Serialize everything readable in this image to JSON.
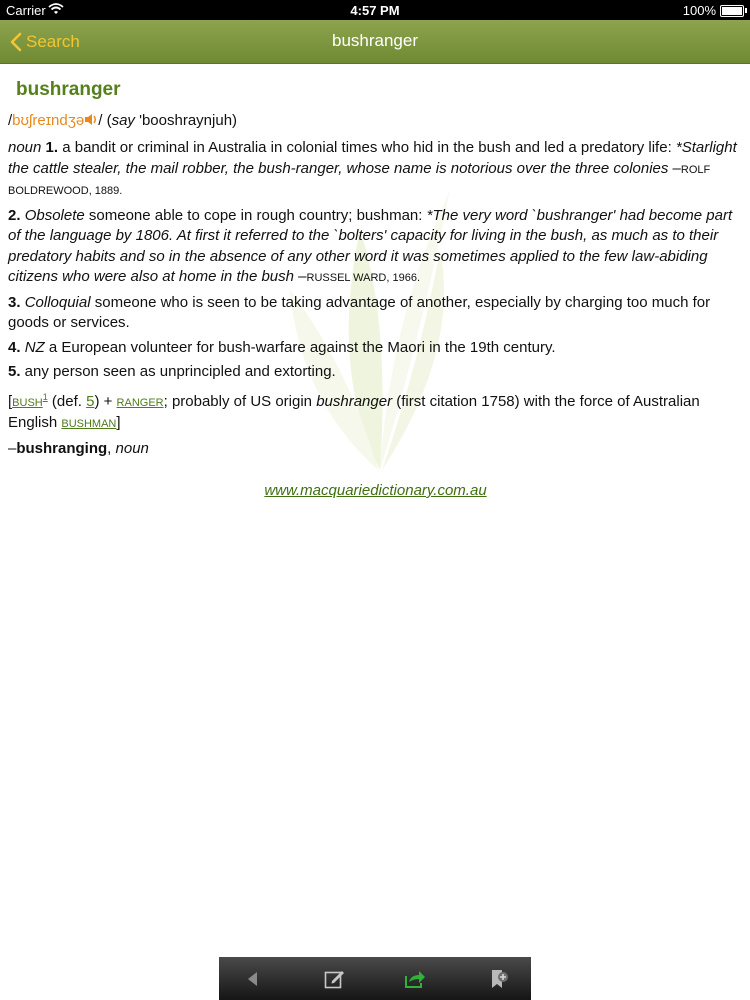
{
  "status_bar": {
    "carrier": "Carrier",
    "time": "4:57 PM",
    "battery": "100%"
  },
  "nav": {
    "back_label": "Search",
    "title": "bushranger"
  },
  "entry": {
    "headword": "bushranger",
    "pron": {
      "slash_open": "/",
      "ipa": "bʊʃreɪndʒə",
      "slash_close": "/ (",
      "say": "say",
      "respelling": " 'booshraynjuh)"
    },
    "senses": [
      {
        "pos": "noun",
        "num": "1.",
        "text": "  a bandit or criminal in Australia in colonial times who hid in the bush and led a predatory life: ",
        "quote": "*Starlight the cattle stealer, the mail robber, the bush-ranger, whose name is notorious over the three colonies",
        "dash": " –",
        "author": "Rolf Boldrewood",
        "year": ", 1889."
      },
      {
        "num": "2.",
        "label": "Obsolete",
        "text": " someone able to cope in rough country; bushman: ",
        "quote": "*The very word `bushranger' had become part of the language by 1806. At first it referred to the `bolters' capacity for living in the bush, as much as to their predatory habits and so in the absence of any other word it was sometimes applied to the few law-abiding citizens who were also at home in the bush",
        "dash": " –",
        "author": "Russel Ward",
        "year": ", 1966."
      },
      {
        "num": "3.",
        "label": "Colloquial",
        "text": " someone who is seen to be taking advantage of another, especially by charging too much for goods or services."
      },
      {
        "num": "4.",
        "label": "NZ",
        "text": " a European volunteer for bush-warfare against the Maori in the 19th century."
      },
      {
        "num": "5.",
        "text": "  any person seen as unprincipled and extorting."
      }
    ],
    "etymology": {
      "open": "[",
      "bush": "bush",
      "bush_sup": "1",
      "def_open": " (def. ",
      "def_num": "5",
      "def_close": ") + ",
      "ranger": "ranger",
      "text1": "; probably of US origin ",
      "term": "bushranger",
      "text2": " (first citation 1758) with the force of Australian English ",
      "bushman": "bushman",
      "close": "]"
    },
    "derived": {
      "dash": "–",
      "word": "bushranging",
      "comma": ", ",
      "pos": "noun"
    },
    "website": "www.macquariedictionary.com.au"
  },
  "toolbar": {
    "icons": [
      "back-arrow-icon",
      "edit-note-icon",
      "share-icon",
      "bookmark-icon"
    ],
    "share_color": "#2fb13a"
  },
  "colors": {
    "nav_bar": "#7f9841",
    "back_button": "#f3c532",
    "headword": "#56801c",
    "ipa": "#e8891e",
    "link": "#4f7b1b"
  }
}
